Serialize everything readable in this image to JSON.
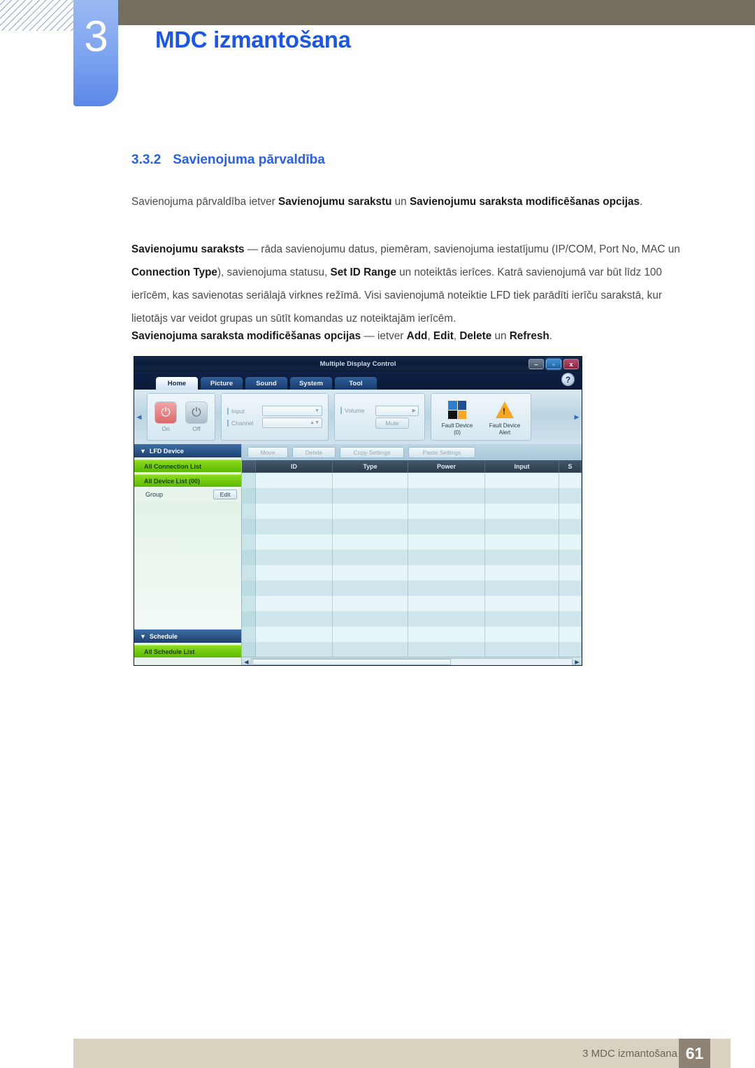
{
  "header": {
    "chapter_number": "3",
    "chapter_title": "MDC izmantošana"
  },
  "section": {
    "number": "3.3.2",
    "title": "Savienojuma pārvaldība"
  },
  "paragraphs": {
    "p1_a": "Savienojuma pārvaldība ietver ",
    "p1_b1": "Savienojumu sarakstu",
    "p1_c": " un ",
    "p1_b2": "Savienojumu saraksta modificēšanas opcijas",
    "p1_d": ".",
    "p2_b1": "Savienojumu saraksts",
    "p2_a": " — rāda savienojumu datus, piemēram, savienojuma iestatījumu (IP/COM, Port No, MAC un ",
    "p2_b2": "Connection Type",
    "p2_c": "), savienojuma statusu, ",
    "p2_b3": "Set ID Range",
    "p2_d": " un noteiktās ierīces. Katrā savienojumā var būt līdz 100 ierīcēm, kas savienotas seriālajā virknes režīmā. Visi savienojumā noteiktie LFD tiek parādīti ierīču sarakstā, kur lietotājs var veidot grupas un sūtīt komandas uz noteiktajām ierīcēm.",
    "p3_b1": "Savienojuma saraksta modificēšanas opcijas",
    "p3_a": " — ietver ",
    "p3_b2": "Add",
    "p3_c": ", ",
    "p3_b3": "Edit",
    "p3_d": ", ",
    "p3_b4": "Delete",
    "p3_e": " un ",
    "p3_b5": "Refresh",
    "p3_f": "."
  },
  "mdc": {
    "window_title": "Multiple Display Control",
    "window_buttons": {
      "minimize": "–",
      "maximize": "▫",
      "close": "x"
    },
    "help_label": "?",
    "tabs": [
      {
        "label": "Home",
        "active": true
      },
      {
        "label": "Picture",
        "active": false
      },
      {
        "label": "Sound",
        "active": false
      },
      {
        "label": "System",
        "active": false
      },
      {
        "label": "Tool",
        "active": false
      }
    ],
    "toolbar": {
      "power_on_label": "On",
      "power_off_label": "Off",
      "power_icon": "⏻",
      "input_label": "Input",
      "input_value": "",
      "channel_label": "Channel",
      "channel_value": "",
      "volume_label": "Volume",
      "volume_value": "",
      "mute_label": "Mute",
      "fault_device_label": "Fault Device",
      "fault_device_count": "(0)",
      "fault_alert_label": "Fault Device",
      "fault_alert_sub": "Alert",
      "left_arrow": "◀",
      "right_arrow": "▶",
      "dropdown_arrow": "▼",
      "spin_arrow": "▲▼",
      "volume_arrow": "▶"
    },
    "sidebar": {
      "lfd_header": "LFD Device",
      "all_connection_list": "All Connection List",
      "all_device_list": "All Device List (00)",
      "group_label": "Group",
      "group_edit_button": "Edit",
      "schedule_header": "Schedule",
      "all_schedule_list": "All Schedule List",
      "collapse_arrow": "▼"
    },
    "actions": [
      {
        "label": "Move"
      },
      {
        "label": "Delete"
      },
      {
        "label": "Copy Settings"
      },
      {
        "label": "Paste Settings"
      }
    ],
    "table": {
      "columns": [
        "ID",
        "Type",
        "Power",
        "Input",
        "S"
      ],
      "rows": []
    },
    "scroll": {
      "left_arrow": "◀",
      "right_arrow": "▶"
    }
  },
  "footer": {
    "text": "3 MDC izmantošana",
    "page": "61"
  },
  "colors": {
    "accent_blue": "#1a56e8",
    "header_olive": "#736f5c",
    "tab_blue": "#7ba2ef",
    "footer_beige": "#d8d2bf",
    "footer_page_box": "#8e8372",
    "sidebar_green": "#6fc40a"
  }
}
